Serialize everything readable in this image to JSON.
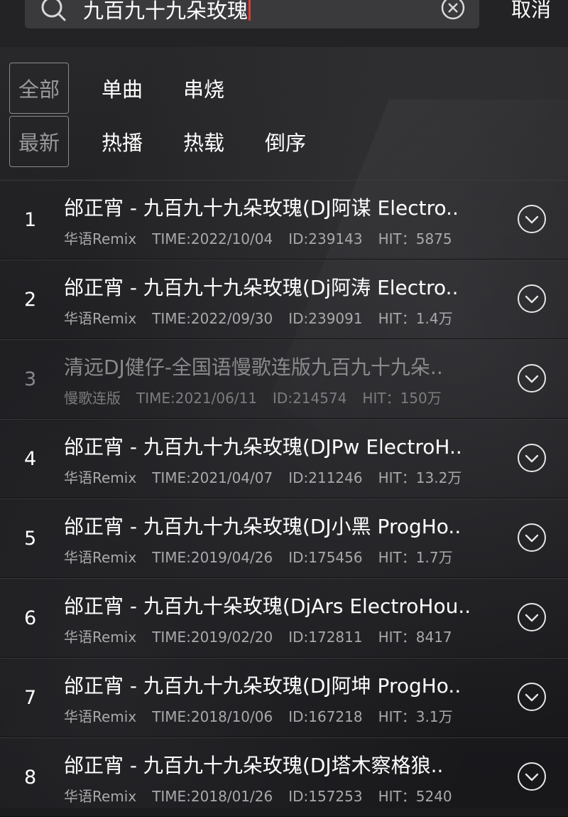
{
  "search": {
    "query": "九百九十九朵玫瑰",
    "cancel_label": "取消"
  },
  "filters": {
    "type_tabs": [
      "全部",
      "单曲",
      "串烧"
    ],
    "sort_tabs": [
      "最新",
      "热播",
      "热载",
      "倒序"
    ]
  },
  "results": [
    {
      "num": "1",
      "title": "邰正宵 - 九百九十九朵玫瑰(DJ阿谋 Electro..",
      "category": "华语Remix",
      "time": "TIME:2022/10/04",
      "id": "ID:239143",
      "hit": "HIT：5875"
    },
    {
      "num": "2",
      "title": "邰正宵 - 九百九十九朵玫瑰(Dj阿涛 Electro..",
      "category": "华语Remix",
      "time": "TIME:2022/09/30",
      "id": "ID:239091",
      "hit": "HIT：1.4万"
    },
    {
      "num": "3",
      "title": "清远DJ健仔-全国语慢歌连版九百九十九朵..",
      "category": "慢歌连版",
      "time": "TIME:2021/06/11",
      "id": "ID:214574",
      "hit": "HIT：150万"
    },
    {
      "num": "4",
      "title": "邰正宵 - 九百九十九朵玫瑰(DJPw ElectroH..",
      "category": "华语Remix",
      "time": "TIME:2021/04/07",
      "id": "ID:211246",
      "hit": "HIT：13.2万"
    },
    {
      "num": "5",
      "title": "邰正宵 - 九百九十九朵玫瑰(DJ小黑 ProgHo..",
      "category": "华语Remix",
      "time": "TIME:2019/04/26",
      "id": "ID:175456",
      "hit": "HIT：1.7万"
    },
    {
      "num": "6",
      "title": "邰正宵 - 九百九十朵玫瑰(DjArs ElectroHou..",
      "category": "华语Remix",
      "time": "TIME:2019/02/20",
      "id": "ID:172811",
      "hit": "HIT：8417"
    },
    {
      "num": "7",
      "title": "邰正宵 - 九百九十九朵玫瑰(DJ阿坤 ProgHo..",
      "category": "华语Remix",
      "time": "TIME:2018/10/06",
      "id": "ID:167218",
      "hit": "HIT：3.1万"
    },
    {
      "num": "8",
      "title": "邰正宵 - 九百九十九朵玫瑰(DJ塔木察格狼..",
      "category": "华语Remix",
      "time": "TIME:2018/01/26",
      "id": "ID:157253",
      "hit": "HIT：5240"
    }
  ]
}
